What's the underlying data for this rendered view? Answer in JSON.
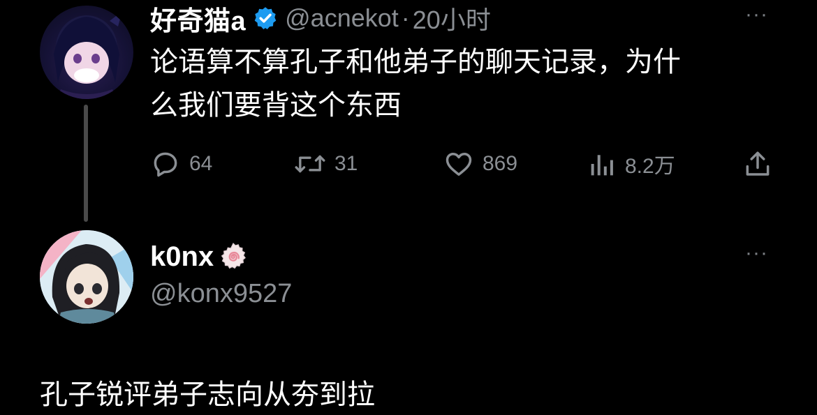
{
  "tweet": {
    "display_name": "好奇猫a",
    "handle": "@acnekot",
    "separator": "·",
    "timestamp": "20小时",
    "more": "···",
    "text_line1": "论语算不算孔子和他弟子的聊天记录，为什",
    "text_line2": "么我们要背这个东西",
    "actions": {
      "reply_count": "64",
      "retweet_count": "31",
      "like_count": "869",
      "view_count": "8.2万"
    },
    "icons": {
      "verified": "verified-badge-icon",
      "reply": "reply-icon",
      "retweet": "retweet-icon",
      "like": "heart-icon",
      "views": "views-icon",
      "share": "share-icon"
    }
  },
  "reply": {
    "display_name": "k0nx",
    "handle": "@konx9527",
    "more": "···",
    "text": "孔子锐评弟子志向从夯到拉",
    "icons": {
      "badge": "naruto-swirl-icon"
    }
  },
  "colors": {
    "background": "#000000",
    "primary_text": "#ffffff",
    "secondary_text": "#8b8f94",
    "verified_blue": "#1d9bf0",
    "thread_line": "#4a4a4a"
  }
}
